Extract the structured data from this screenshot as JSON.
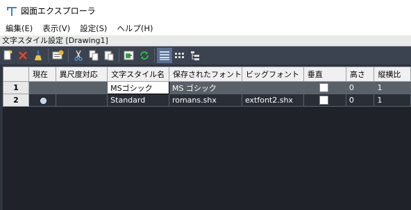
{
  "window": {
    "title": "図面エクスプローラ"
  },
  "menu": [
    {
      "label": "編集(E)"
    },
    {
      "label": "表示(V)"
    },
    {
      "label": "設定(S)"
    },
    {
      "label": "ヘルプ(H)"
    }
  ],
  "panel": {
    "title": "文字スタイル設定 [Drawing1]"
  },
  "toolbar": {
    "icons": [
      "new-icon",
      "delete-icon",
      "purge-icon",
      "set-current-icon",
      "cut-icon",
      "copy-icon",
      "paste-icon",
      "import-icon",
      "refresh-icon",
      "large-icons-view-icon",
      "small-icons-view-icon",
      "tree-view-icon"
    ]
  },
  "table": {
    "headers": [
      "",
      "現在",
      "異尺度対応",
      "文字スタイル名",
      "保存されたフォント",
      "ビッグフォント",
      "垂直",
      "高さ",
      "縦横比"
    ],
    "rows": [
      {
        "num": "1",
        "current": "",
        "annotative": "",
        "name": "MSゴシック",
        "font": "MS ゴシック",
        "bigfont": "",
        "height": "0",
        "ratio": "1"
      },
      {
        "num": "2",
        "current": "●",
        "annotative": "",
        "name": "Standard",
        "font": "romans.shx",
        "bigfont": "extfont2.shx",
        "height": "0",
        "ratio": "1"
      }
    ]
  },
  "colors": {
    "background": "#2f353f",
    "grid": "#1f2329",
    "accent": "#2e86de"
  }
}
